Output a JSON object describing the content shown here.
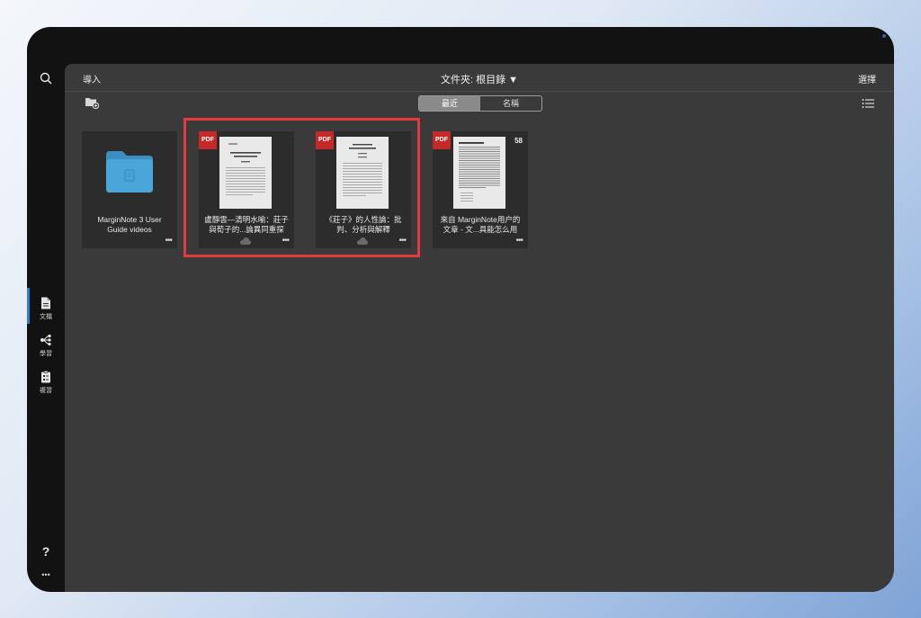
{
  "toolbar": {
    "import_label": "導入",
    "folder_title": "文件夾: 根目錄 ▼",
    "select_label": "選擇"
  },
  "sort_segment": {
    "recent_label": "最近",
    "name_label": "名稱",
    "selected": "最近"
  },
  "sidebar": {
    "items": [
      {
        "label": "文檔",
        "icon": "document-icon",
        "active": true
      },
      {
        "label": "學習",
        "icon": "mindmap-icon",
        "active": false
      },
      {
        "label": "複習",
        "icon": "flashcard-icon",
        "active": false
      }
    ],
    "help_label": "?",
    "more_label": "•••"
  },
  "documents": [
    {
      "type": "folder",
      "title": "MarginNote 3 User Guide videos"
    },
    {
      "type": "pdf",
      "badge": "PDF",
      "title": "盧靜雲—清明水喻：莊子與荀子的...論異同重探",
      "cloud": true
    },
    {
      "type": "pdf",
      "badge": "PDF",
      "title": "《莊子》的人性論：批判、分析與解釋",
      "cloud": true
    },
    {
      "type": "pdf",
      "badge": "PDF",
      "title": "來自 MarginNote用户的文章 - 文...具能怎么用",
      "count": "58",
      "cloud": false
    }
  ],
  "colors": {
    "highlight": "#e53940",
    "pdf_badge": "#c62828",
    "folder": "#4aa6d8",
    "active_accent": "#2f7bd6"
  }
}
